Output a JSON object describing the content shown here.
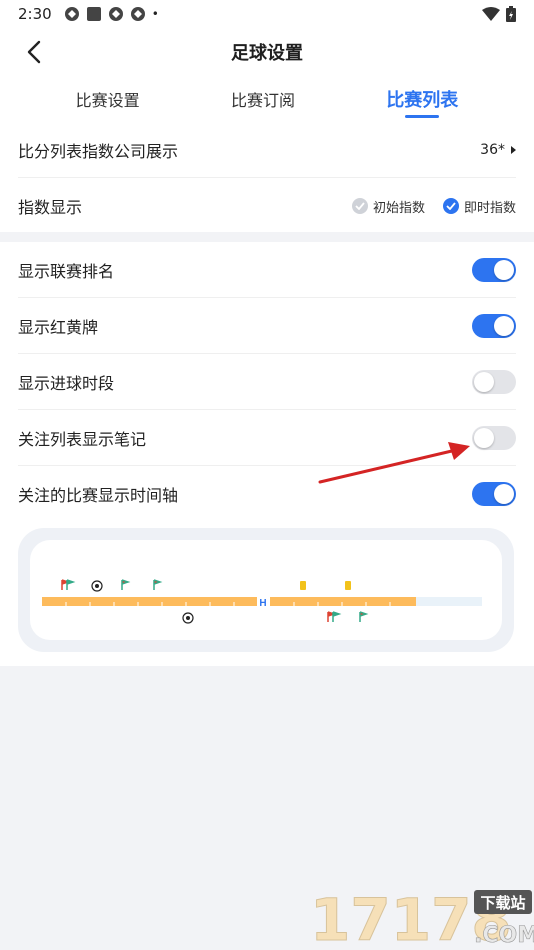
{
  "status_bar": {
    "time": "2:30",
    "dot": "•"
  },
  "header": {
    "title": "足球设置"
  },
  "tabs": [
    {
      "label": "比赛设置",
      "active": false
    },
    {
      "label": "比赛订阅",
      "active": false
    },
    {
      "label": "比赛列表",
      "active": true
    }
  ],
  "settings_top": {
    "company_row": {
      "label": "比分列表指数公司展示",
      "value": "36*"
    },
    "index_row": {
      "label": "指数显示",
      "options": [
        {
          "label": "初始指数",
          "checked": false
        },
        {
          "label": "即时指数",
          "checked": true
        }
      ]
    }
  },
  "toggles": [
    {
      "label": "显示联赛排名",
      "on": true
    },
    {
      "label": "显示红黄牌",
      "on": true
    },
    {
      "label": "显示进球时段",
      "on": false
    },
    {
      "label": "关注列表显示笔记",
      "on": false
    },
    {
      "label": "关注的比赛显示时间轴",
      "on": true
    }
  ],
  "timeline_preview": {
    "halftime_marker": "H"
  },
  "colors": {
    "accent": "#2d74f0",
    "timeline": "#fdbb5c",
    "annotation_arrow": "#d42424"
  },
  "watermark": {
    "text": "17178",
    "badge": "下载站",
    "domain": ".COM"
  }
}
